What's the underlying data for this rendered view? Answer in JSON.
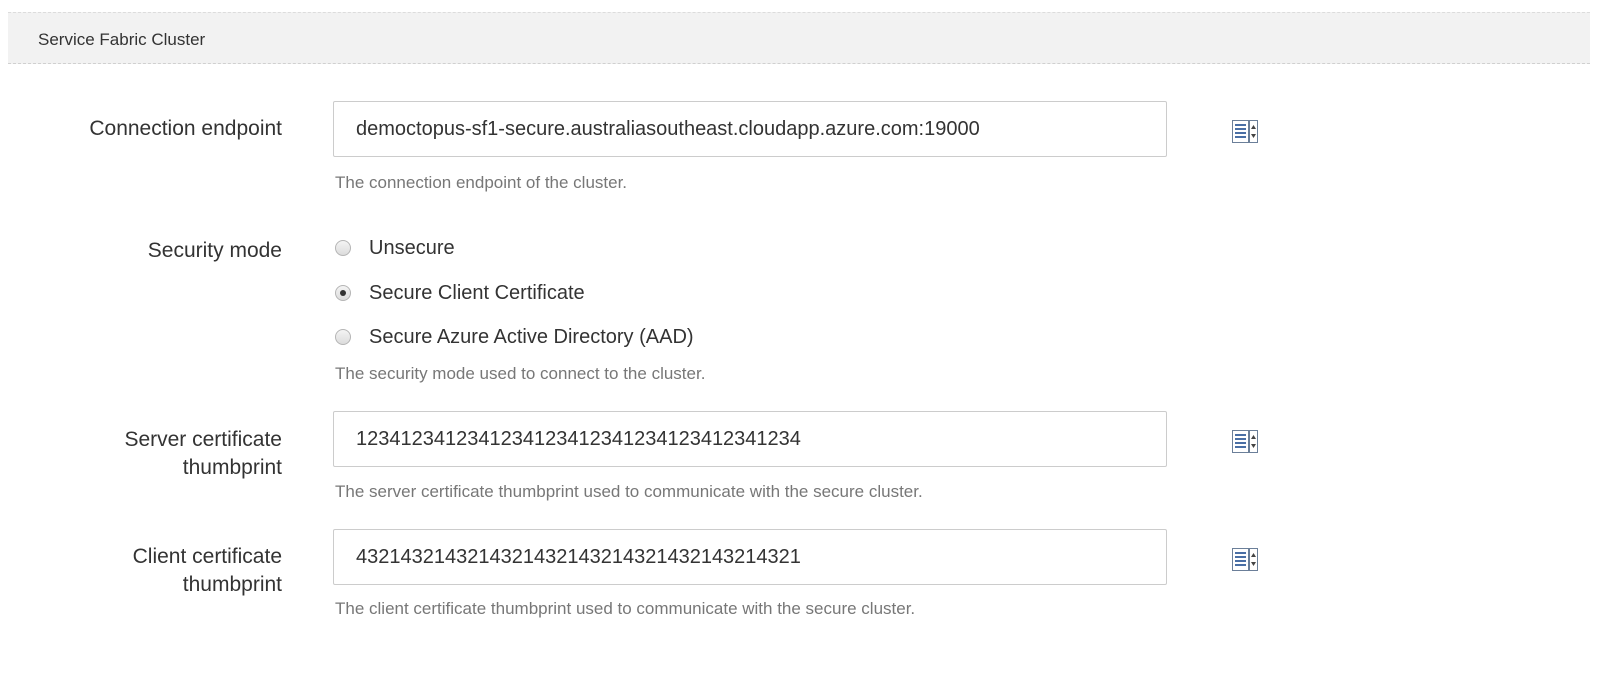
{
  "section": {
    "title": "Service Fabric Cluster"
  },
  "fields": {
    "connection_endpoint": {
      "label": "Connection endpoint",
      "value": "democtopus-sf1-secure.australiasoutheast.cloudapp.azure.com:19000",
      "help": "The connection endpoint of the cluster."
    },
    "security_mode": {
      "label": "Security mode",
      "options": [
        {
          "label": "Unsecure",
          "checked": false
        },
        {
          "label": "Secure Client Certificate",
          "checked": true
        },
        {
          "label": "Secure Azure Active Directory (AAD)",
          "checked": false
        }
      ],
      "help": "The security mode used to connect to the cluster."
    },
    "server_thumbprint": {
      "label_line1": "Server certificate",
      "label_line2": "thumbprint",
      "value": "1234123412341234123412341234123412341234",
      "help": "The server certificate thumbprint used to communicate with the secure cluster."
    },
    "client_thumbprint": {
      "label_line1": "Client certificate",
      "label_line2": "thumbprint",
      "value": "4321432143214321432143214321432143214321",
      "help": "The client certificate thumbprint used to communicate with the secure cluster."
    }
  },
  "icons": {
    "variable_binding": "variable-lookup-icon"
  },
  "colors": {
    "header_bg": "#f2f2f2",
    "help_text": "#777777",
    "icon_blue": "#4a6fa5"
  }
}
